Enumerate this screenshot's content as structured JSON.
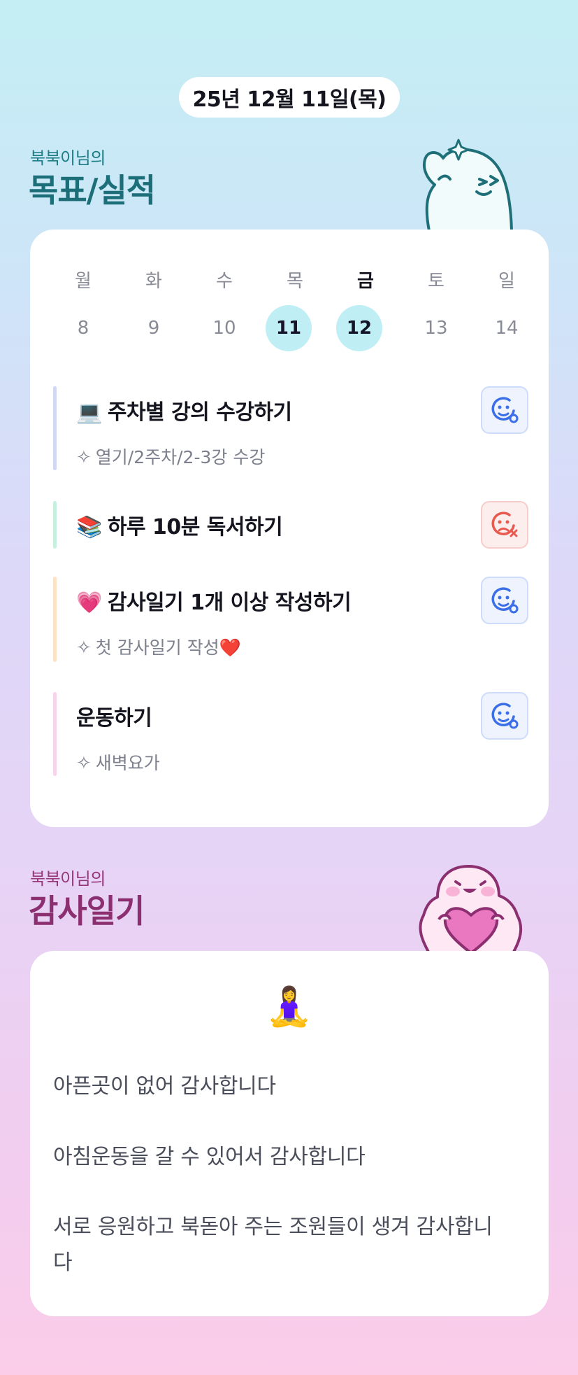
{
  "header": {
    "date": "25년 12월 11일(목)"
  },
  "goals_section": {
    "subtitle": "북북이님의",
    "title": "목표/실적"
  },
  "week": {
    "weekdays": [
      "월",
      "화",
      "수",
      "목",
      "금",
      "토",
      "일"
    ],
    "days": [
      "8",
      "9",
      "10",
      "11",
      "12",
      "13",
      "14"
    ],
    "active_weekday": "금",
    "selected_days": [
      "11",
      "12"
    ]
  },
  "goals": [
    {
      "emoji": "💻",
      "title": "주차별 강의 수강하기",
      "note": "열기/2주차/2-3강 수강",
      "status": "done",
      "bar_color": "#cfd8f5"
    },
    {
      "emoji": "📚",
      "title": "하루 10분 독서하기",
      "note": "",
      "status": "failed",
      "bar_color": "#c6efdd"
    },
    {
      "emoji": "💗",
      "title": "감사일기 1개 이상 작성하기",
      "note": "첫 감사일기 작성❤️",
      "status": "done",
      "bar_color": "#fde3c5"
    },
    {
      "emoji": "",
      "title": "운동하기",
      "note": "새벽요가",
      "status": "done",
      "bar_color": "#f8d3ec"
    }
  ],
  "gratitude_section": {
    "subtitle": "북북이님의",
    "title": "감사일기"
  },
  "gratitude": {
    "emoji": "🧘‍♀️",
    "lines": [
      "아픈곳이 없어 감사합니다",
      "아침운동을 갈 수 있어서 감사합니다",
      "서로 응원하고 북돋아 주는 조원들이 생겨 감사합니",
      "다"
    ]
  },
  "colors": {
    "goal_title": "#1c6f78",
    "gratitude_title": "#8c2f70",
    "selected_day": "#bfeef5",
    "status_ok": "#3b6fe8",
    "status_bad": "#e85a4f"
  },
  "icons": {
    "status_done": "smile-face-icon",
    "status_failed": "sad-face-x-icon",
    "note": "sparkle-icon"
  }
}
